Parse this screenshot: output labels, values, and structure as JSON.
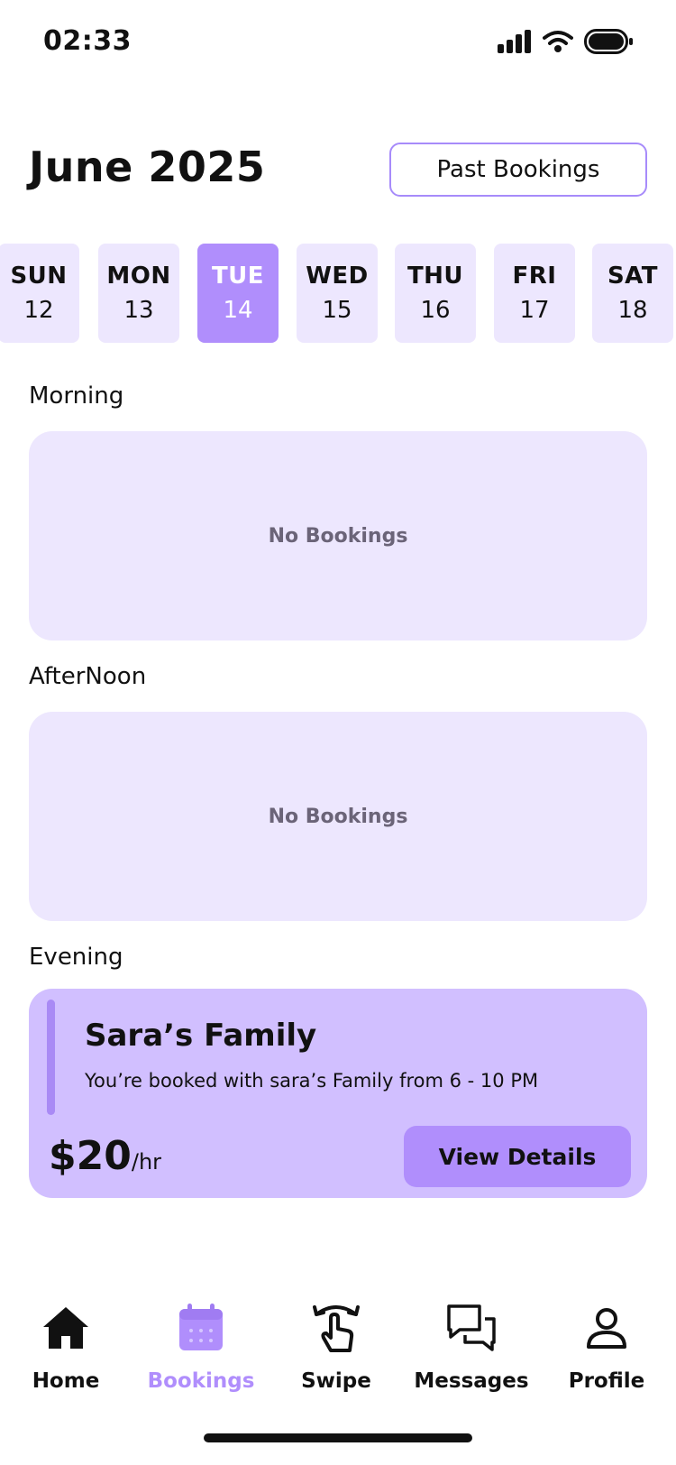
{
  "status_bar": {
    "time": "02:33"
  },
  "header": {
    "title": "June 2025",
    "past_bookings_label": "Past Bookings"
  },
  "days": [
    {
      "name": "SUN",
      "num": "12",
      "active": false
    },
    {
      "name": "MON",
      "num": "13",
      "active": false
    },
    {
      "name": "TUE",
      "num": "14",
      "active": true
    },
    {
      "name": "WED",
      "num": "15",
      "active": false
    },
    {
      "name": "THU",
      "num": "16",
      "active": false
    },
    {
      "name": "FRI",
      "num": "17",
      "active": false
    },
    {
      "name": "SAT",
      "num": "18",
      "active": false
    }
  ],
  "sections": {
    "morning": {
      "label": "Morning",
      "empty_text": "No Bookings"
    },
    "afternoon": {
      "label": "AfterNoon",
      "empty_text": "No Bookings"
    },
    "evening": {
      "label": "Evening",
      "booking": {
        "title": "Sara’s Family",
        "description": "You’re booked with sara’s Family from 6 - 10 PM",
        "price": "$20",
        "unit": "/hr",
        "button_label": "View Details"
      }
    }
  },
  "tabs": [
    {
      "label": "Home",
      "icon": "home-icon",
      "active": false
    },
    {
      "label": "Bookings",
      "icon": "calendar-icon",
      "active": true
    },
    {
      "label": "Swipe",
      "icon": "swipe-icon",
      "active": false
    },
    {
      "label": "Messages",
      "icon": "messages-icon",
      "active": false
    },
    {
      "label": "Profile",
      "icon": "profile-icon",
      "active": false
    }
  ],
  "colors": {
    "accent": "#b08efc",
    "accent_light": "#ede7fe",
    "card_booked": "#d1bfff",
    "outline": "#a78bfa"
  }
}
